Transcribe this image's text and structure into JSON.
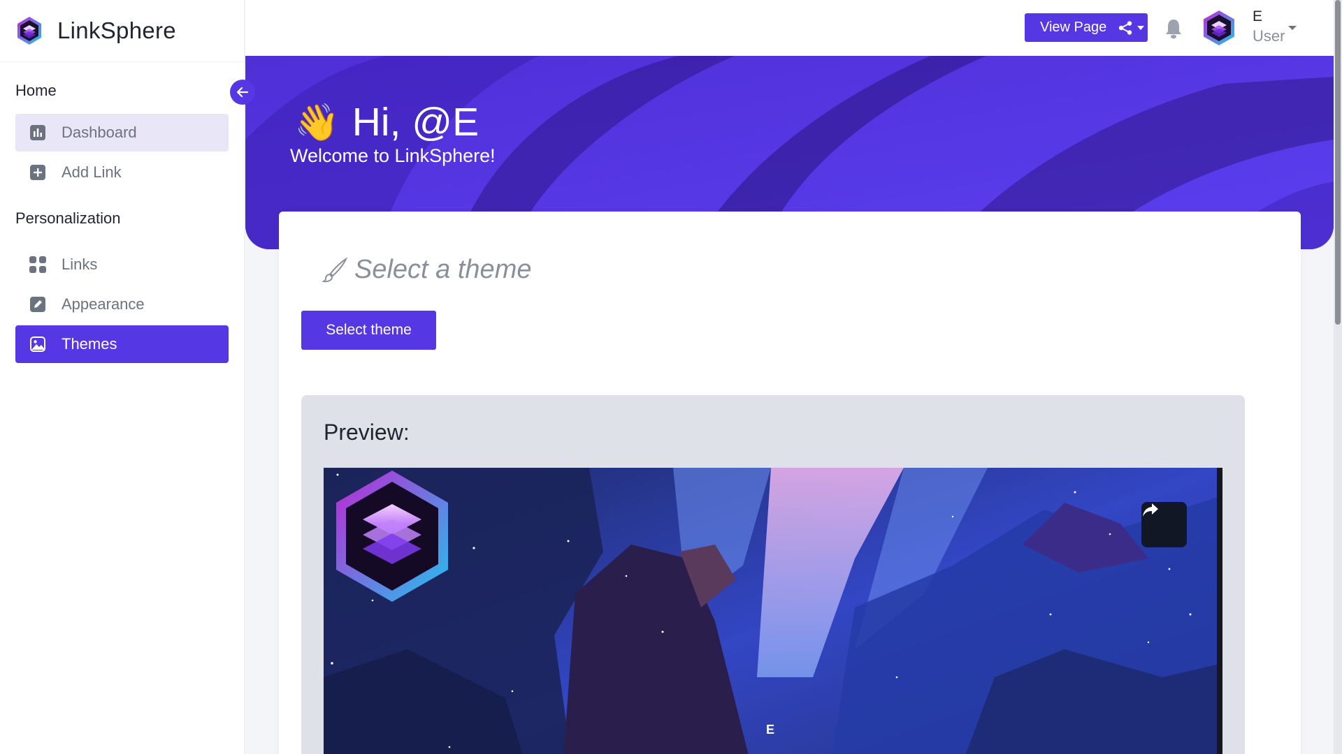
{
  "brand": {
    "name": "LinkSphere"
  },
  "sidebar": {
    "sections": [
      {
        "title": "Home"
      },
      {
        "title": "Personalization"
      }
    ],
    "home_items": [
      {
        "label": "Dashboard",
        "icon": "chart-icon"
      },
      {
        "label": "Add Link",
        "icon": "plus-square-icon"
      }
    ],
    "pers_items": [
      {
        "label": "Links",
        "icon": "grid-icon"
      },
      {
        "label": "Appearance",
        "icon": "edit-icon"
      },
      {
        "label": "Themes",
        "icon": "image-icon"
      }
    ]
  },
  "topbar": {
    "view_label": "View Page",
    "user_name": "E",
    "user_role": "User"
  },
  "hero": {
    "wave": "👋",
    "greeting": "Hi, @E",
    "subtitle": "Welcome to LinkSphere!"
  },
  "card": {
    "title": "Select a theme",
    "button_label": "Select theme",
    "preview_label": "Preview:",
    "preview_name": "E"
  },
  "colors": {
    "accent": "#5538e3",
    "hero": "#5a3ce8",
    "preview_bg": "#1b2456"
  }
}
